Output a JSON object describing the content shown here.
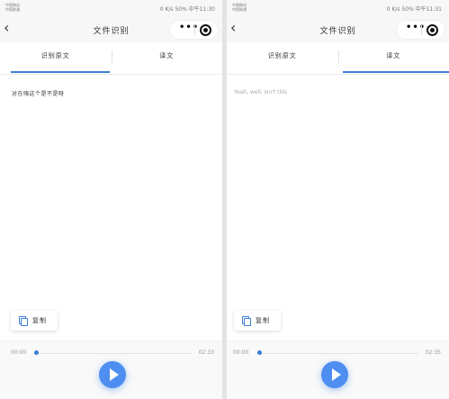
{
  "screens": [
    {
      "status": {
        "carrier_line1": "中国移动",
        "carrier_line2": "中国联通",
        "right": "0 K/s  50%  中午11:30"
      },
      "nav": {
        "title": "文件识别",
        "more_icon": "•••",
        "target_icon": "record-icon",
        "back_icon": "back-chevron-icon"
      },
      "tabs": [
        {
          "label": "识别原文"
        },
        {
          "label": "译文"
        }
      ],
      "active_tab": 0,
      "content_text": "对在嗨这个是不是呀",
      "copy_label": "复制",
      "player": {
        "current": "00:00",
        "total": "02:33",
        "progress": 0.0
      }
    },
    {
      "status": {
        "carrier_line1": "中国移动",
        "carrier_line2": "中国联通",
        "right": "0 K/s  50%  中午11:31"
      },
      "nav": {
        "title": "文件识别",
        "more_icon": "•••",
        "target_icon": "record-icon",
        "back_icon": "back-chevron-icon"
      },
      "tabs": [
        {
          "label": "识别原文"
        },
        {
          "label": "译文"
        }
      ],
      "active_tab": 1,
      "content_text": "Yeah, well, isn't this",
      "copy_label": "复制",
      "player": {
        "current": "00:00",
        "total": "02:35",
        "progress": 0.0
      }
    }
  ],
  "colors": {
    "accent": "#3b7fd6",
    "play_button": "#4d8ef0"
  }
}
